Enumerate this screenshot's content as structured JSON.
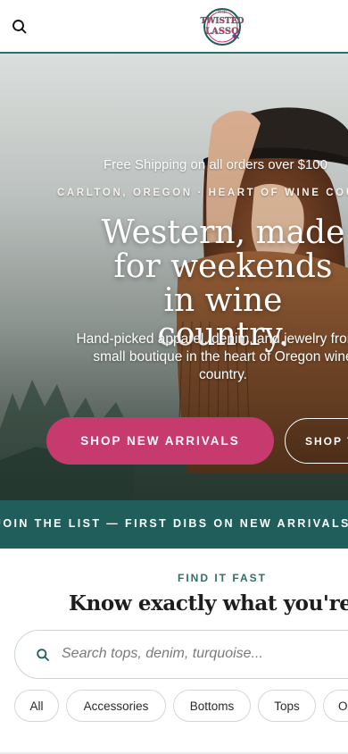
{
  "header": {
    "logo_top": "THE",
    "logo_line1": "TWISTED",
    "logo_line2": "LASSO"
  },
  "hero": {
    "shipping": "Free Shipping on all orders over $100",
    "eyebrow": "CARLTON, OREGON · HEART OF WINE COUNTRY",
    "title": "Western, made for weekends in wine country.",
    "subtitle": "Hand-picked apparel, denim, and jewelry from a small boutique in the heart of Oregon wine country.",
    "primary_cta": "SHOP NEW ARRIVALS",
    "secondary_cta": "SHOP THE LOOK"
  },
  "marquee": {
    "text": "JOIN THE LIST — FIRST DIBS ON NEW ARRIVALS"
  },
  "find": {
    "eyebrow": "FIND IT FAST",
    "title": "Know exactly what you're after?",
    "search_placeholder": "Search tops, denim, turquoise...",
    "chips": [
      "All",
      "Accessories",
      "Bottoms",
      "Tops",
      "Outerwear"
    ]
  },
  "colors": {
    "brand_teal": "#1f5e5a",
    "accent_pink": "#c73a6e"
  }
}
